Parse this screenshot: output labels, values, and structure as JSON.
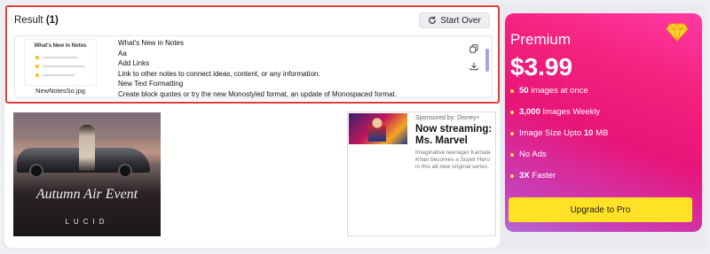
{
  "result": {
    "title": "Result",
    "count": "(1)",
    "start_over_label": "Start Over"
  },
  "file": {
    "thumbnail_title": "What's New in Notes",
    "name": "NewNotesSo.jpg",
    "text_lines": [
      "What's New in Notes",
      "Aa",
      "Add Links",
      "Link to other notes to connect ideas, content, or any information.",
      "New Text Formatting",
      "Create block quotes or try the new Monostyled format, an update of Monospaced format."
    ],
    "icons": {
      "copy": "copy-icon",
      "download": "download-icon"
    }
  },
  "ad_left": {
    "event": "Autumn Air Event",
    "brand": "LUCID"
  },
  "ad_right": {
    "sponsor": "Sponsored by: Disney+",
    "headline": "Now streaming: Ms. Marvel",
    "description": "Imaginative teenager Kamala Khan becomes a Super Hero in this all-new original series."
  },
  "premium": {
    "title": "Premium",
    "price": "$3.99",
    "features": [
      {
        "bold": "50",
        "text": " images at once"
      },
      {
        "bold": "3,000",
        "text": " Images Weekly"
      },
      {
        "bold": "",
        "text": "Image Size Upto ",
        "bold_suffix": "10",
        "suffix": " MB"
      },
      {
        "bold": "",
        "text": "No Ads"
      },
      {
        "bold": "3X",
        "text": " Faster"
      }
    ],
    "upgrade_label": "Upgrade to Pro",
    "colors": {
      "accent": "#ffe225",
      "gradient_start": "#ff3aa4",
      "gradient_end": "#b26ad6"
    }
  },
  "colors": {
    "highlight_border": "#e23b3b"
  }
}
